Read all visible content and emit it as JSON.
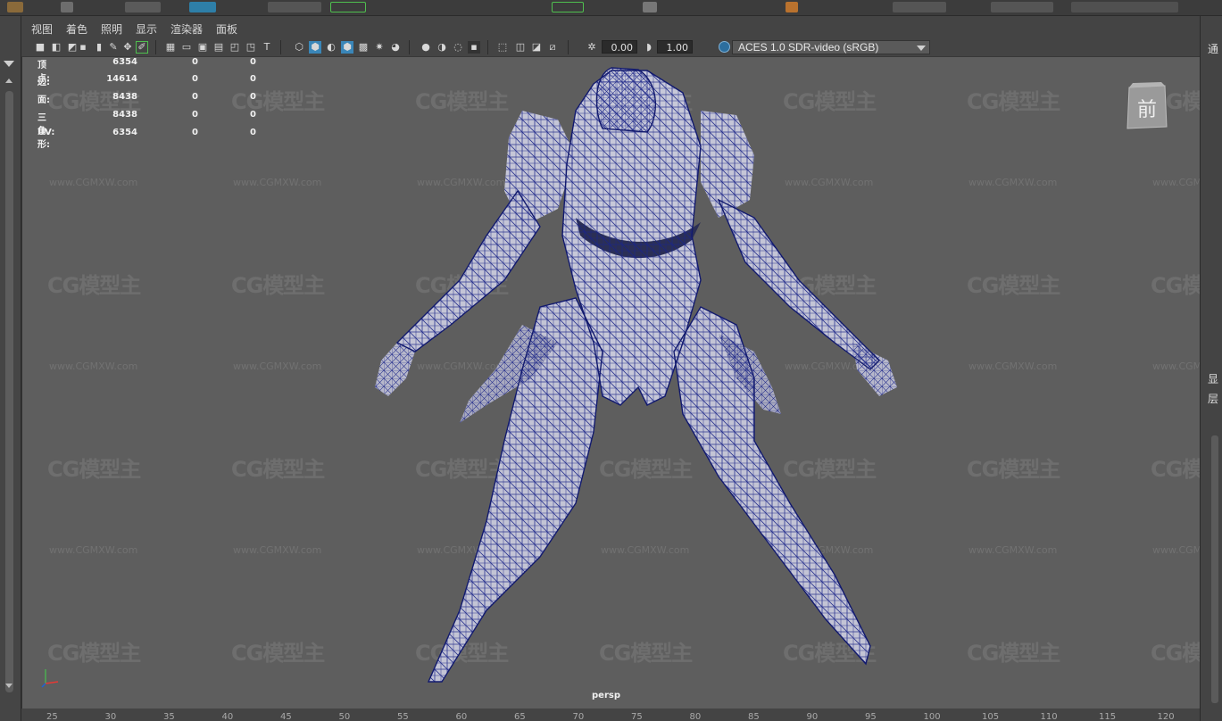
{
  "panel": {
    "menu": [
      "视图",
      "着色",
      "照明",
      "显示",
      "渲染器",
      "面板"
    ],
    "exposure_value": "0.00",
    "gamma_value": "1.00",
    "color_space": "ACES 1.0 SDR-video (sRGB)"
  },
  "hud": {
    "rows": [
      {
        "label": "顶点:",
        "values": [
          "6354",
          "0",
          "0"
        ]
      },
      {
        "label": "边:",
        "values": [
          "14614",
          "0",
          "0"
        ]
      },
      {
        "label": "面:",
        "values": [
          "8438",
          "0",
          "0"
        ]
      },
      {
        "label": "三角形:",
        "values": [
          "8438",
          "0",
          "0"
        ]
      },
      {
        "label": "UV:",
        "values": [
          "6354",
          "0",
          "0"
        ]
      }
    ]
  },
  "viewport": {
    "camera_label": "persp",
    "view_cube_face": "前",
    "watermark_logo": "CG模型主",
    "watermark_url": "www.CGMXW.com",
    "model_fill": "#c9cad8",
    "wire_color": "#1b2588"
  },
  "right_panel": {
    "texts": [
      "通",
      "显",
      "层"
    ]
  },
  "ruler": {
    "ticks": [
      "25",
      "30",
      "35",
      "40",
      "45",
      "50",
      "55",
      "60",
      "65",
      "70",
      "75",
      "80",
      "85",
      "90",
      "95",
      "100",
      "105",
      "110",
      "115",
      "120"
    ]
  },
  "icons": {
    "view_cube": "view-cube-icon",
    "axis": "axis-gizmo-icon"
  }
}
